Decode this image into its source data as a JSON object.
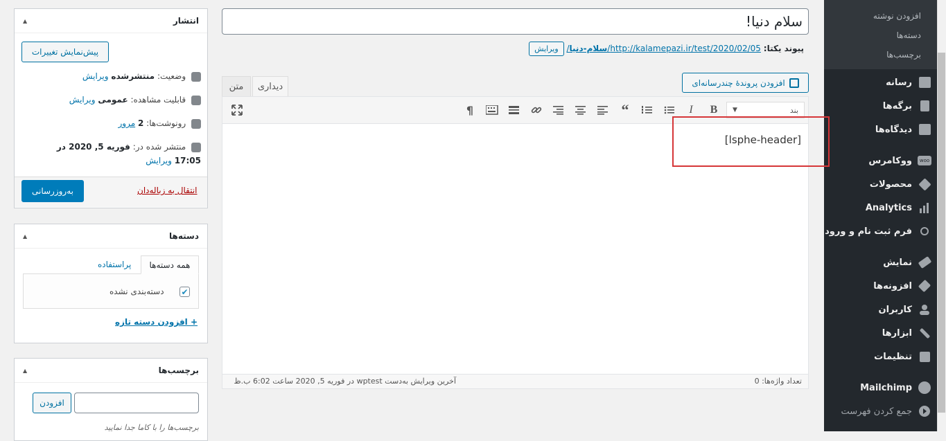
{
  "title_value": "سلام دنیا!",
  "permalink": {
    "label": "پیوند یکتا:",
    "url": "http://kalamepazi.ir/test/2020/02/05/",
    "slug": "سلام-دنیا",
    "slash": "/",
    "edit": "ویرایش"
  },
  "media_button": "افزودن پروندهٔ چندرسانه‌ای",
  "tabs": {
    "visual": "دیداری",
    "text": "متن"
  },
  "format_select": "بند",
  "toolbar": {
    "bold": "B",
    "italic": "I",
    "paragraph_mark": "¶"
  },
  "content": "[lsphe-header]",
  "status": {
    "word_count": "تعداد واژه‌ها: 0",
    "last_edit": "آخرین ویرایش به‌دست wptest در فوریه 5, 2020 ساعت 6:02 ب.ظ"
  },
  "publish": {
    "title": "انتشار",
    "preview": "پیش‌نمایش تغییرات",
    "status_label": "وضعیت:",
    "status_value": "منتشرشده",
    "status_edit": "ویرایش",
    "visibility_label": "قابلیت مشاهده:",
    "visibility_value": "عمومی",
    "visibility_edit": "ویرایش",
    "revisions_label": "رونوشت‌ها:",
    "revisions_value": "2",
    "revisions_link": "مرور",
    "published_label": "منتشر شده در:",
    "published_value": "فوریه 5, 2020 در",
    "published_time": "17:05",
    "published_edit": "ویرایش",
    "trash": "انتقال به زباله‌دان",
    "update": "به‌روزرسانی"
  },
  "categories": {
    "title": "دسته‌ها",
    "tab_all": "همه دسته‌ها",
    "tab_popular": "پراستفاده",
    "item": "دسته‌بندی نشده",
    "add_new": "+ افزودن دسته تازه"
  },
  "tags": {
    "title": "برچسب‌ها",
    "add": "افزودن",
    "hint": "برچسب‌ها را با کاما جدا نمایید"
  },
  "sidebar": {
    "submenu": [
      "افزودن نوشته",
      "دسته‌ها",
      "برچسب‌ها"
    ],
    "items": [
      "رسانه",
      "برگه‌ها",
      "دیدگاه‌ها",
      "ووکامرس",
      "محصولات",
      "Analytics",
      "فرم ثبت نام و ورود",
      "نمایش",
      "افزونه‌ها",
      "کاربران",
      "ابزارها",
      "تنظیمات",
      "Mailchimp",
      "جمع کردن فهرست"
    ],
    "woo_badge": "woo"
  },
  "colors": {
    "accent": "#0073aa",
    "sidebar": "#23282d",
    "highlight": "#d63638",
    "primary_button": "#007cba"
  }
}
